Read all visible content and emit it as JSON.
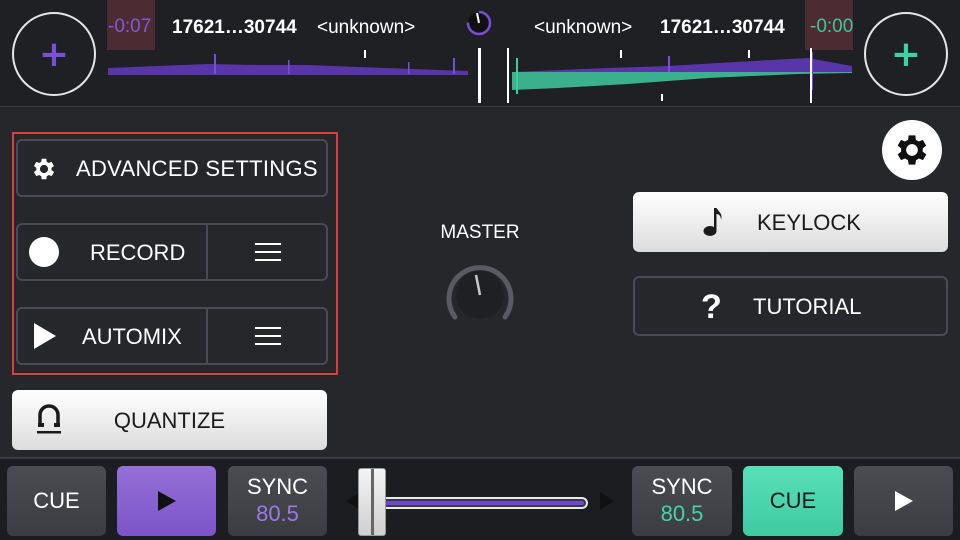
{
  "deck_a": {
    "time_remaining": "-0:07",
    "track_id": "17621…30744",
    "track_name": "<unknown>",
    "add_icon": "plus-icon",
    "accent_color": "#7b4ddb",
    "bpm": "80.5",
    "cue_label": "CUE",
    "sync_label": "SYNC"
  },
  "deck_b": {
    "time_remaining": "-0:00",
    "track_id": "17621…30744",
    "track_name": "<unknown>",
    "add_icon": "plus-icon",
    "accent_color": "#3ad3a4",
    "bpm": "80.5",
    "cue_label": "CUE",
    "sync_label": "SYNC"
  },
  "left_panel": {
    "advanced_settings": {
      "label": "ADVANCED SETTINGS",
      "icon": "gear-icon"
    },
    "record": {
      "label": "RECORD",
      "icon": "record-dot-icon",
      "menu_icon": "hamburger-icon"
    },
    "automix": {
      "label": "AUTOMIX",
      "icon": "play-icon",
      "menu_icon": "hamburger-icon"
    },
    "quantize": {
      "label": "QUANTIZE",
      "icon": "magnet-icon"
    }
  },
  "center": {
    "master_label": "MASTER"
  },
  "right_panel": {
    "settings_icon": "gear-icon",
    "keylock": {
      "label": "KEYLOCK",
      "icon": "music-note-icon"
    },
    "tutorial": {
      "label": "TUTORIAL",
      "icon": "?"
    }
  },
  "crossfader": {
    "value": 0.0
  }
}
